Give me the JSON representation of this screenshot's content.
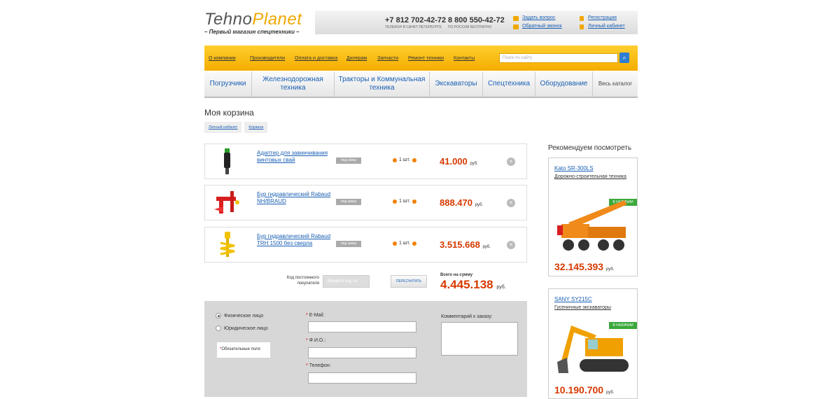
{
  "brand": {
    "logo_part1": "Tehno",
    "logo_part2": "Planet",
    "tagline": "– Первый магазин спецтехники –"
  },
  "header": {
    "phone1": "+7 812 702-42-72",
    "phone1_note": "телефон в Санкт-Петербурге",
    "phone2": "8 800 550-42-72",
    "phone2_note": "по России бесплатно",
    "ask_question": "Задать вопрос",
    "callback": "Обратный звонок",
    "register": "Регистрация",
    "account": "Личный кабинет"
  },
  "menu": {
    "items": [
      "О компании",
      "Производители",
      "Оплата и доставка",
      "Дилерам",
      "Запчасти",
      "Ремонт техники",
      "Контакты"
    ],
    "search_placeholder": "Поиск по сайту"
  },
  "categories": [
    "Погрузчики",
    "Железнодорожная техника",
    "Тракторы и Коммунальная техника",
    "Экскаваторы",
    "Спецтехника",
    "Оборудование",
    "Весь каталог"
  ],
  "page": {
    "title": "Моя корзина",
    "breadcrumbs": [
      "Личный кабинет",
      "Корзина"
    ]
  },
  "cart": {
    "items": [
      {
        "name": "Адаптер для завинчивания винтовых свай",
        "badge": "под заказ",
        "qty": "1 шт.",
        "price": "41.000",
        "currency": "руб."
      },
      {
        "name": "Бур гидравлический Rabaud NH/BRAUD",
        "badge": "под заказ",
        "qty": "1 шт.",
        "price": "888.470",
        "currency": "руб."
      },
      {
        "name": "Бур гидравлический Rabaud TRH 1500 без сверла",
        "badge": "под заказ",
        "qty": "1 шт.",
        "price": "3.515.668",
        "currency": "руб."
      }
    ],
    "code_label": "Код постоянного покупателя",
    "code_placeholder": "Введите код по",
    "recalc": "пересчитать",
    "total_label": "Всего на сумму",
    "total": "4.445.138",
    "total_currency": "руб."
  },
  "form": {
    "individual": "Физическое лицо",
    "legal": "Юридическое лицо",
    "required_note": "Обязательные поля",
    "email_label": "E-Mail:",
    "name_label": "Ф.И.О.:",
    "phone_label": "Телефон:",
    "comment_label": "Комментарий к заказу:"
  },
  "sidebar": {
    "title": "Рекомендуем посмотреть",
    "items": [
      {
        "name": "Kato SR-300LS",
        "category": "Дорожно-строительная техника",
        "stock": "в наличии",
        "price": "32.145.393",
        "currency": "руб."
      },
      {
        "name": "SANY SY215C",
        "category": "Гусеничные экскаваторы",
        "stock": "в наличии",
        "price": "10.190.700",
        "currency": "руб."
      }
    ]
  }
}
